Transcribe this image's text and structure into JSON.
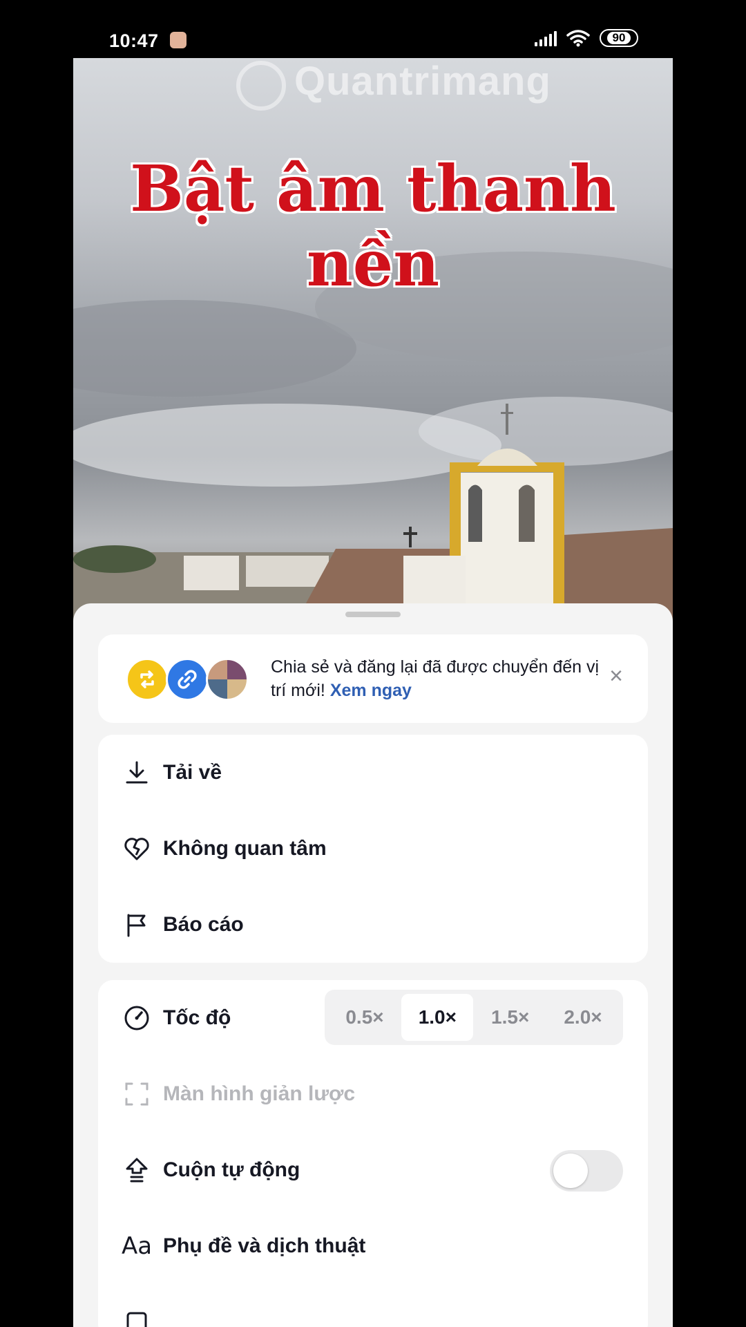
{
  "status_bar": {
    "time": "10:47",
    "battery": "90"
  },
  "video": {
    "watermark": "Quantrimang",
    "caption": "Bật âm thanh nền"
  },
  "banner": {
    "text": "Chia sẻ và đăng lại đã được chuyển đến vị trí mới!",
    "link": "Xem ngay",
    "close_icon": "close-icon"
  },
  "menu_group_1": [
    {
      "icon": "download-icon",
      "label": "Tải về"
    },
    {
      "icon": "broken-heart-icon",
      "label": "Không quan tâm"
    },
    {
      "icon": "flag-icon",
      "label": "Báo cáo"
    }
  ],
  "menu_group_2": {
    "speed": {
      "label": "Tốc độ",
      "icon": "speedometer-icon",
      "options": [
        "0.5×",
        "1.0×",
        "1.5×",
        "2.0×"
      ],
      "selected": "1.0×"
    },
    "clear_mode": {
      "label": "Màn hình giản lược",
      "icon": "clear-mode-icon",
      "disabled": true
    },
    "auto_scroll": {
      "label": "Cuộn tự động",
      "icon": "auto-scroll-icon",
      "enabled": false
    },
    "captions": {
      "label": "Phụ đề và dịch thuật",
      "icon": "captions-icon"
    }
  },
  "colors": {
    "accent_link": "#2f5fb3",
    "caption_red": "#d0111b",
    "sheet_bg": "#f4f4f4"
  }
}
